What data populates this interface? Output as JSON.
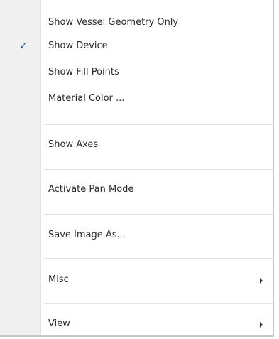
{
  "menu": {
    "items": [
      {
        "label": "Show Vessel Geometry Only"
      },
      {
        "label": "Show Device",
        "checked": true,
        "check_glyph": "✓"
      },
      {
        "label": "Show Fill Points"
      },
      {
        "label": "Material Color ..."
      },
      {
        "label": "Show Axes"
      },
      {
        "label": "Activate Pan Mode"
      },
      {
        "label": "Save Image As..."
      },
      {
        "label": "Misc",
        "has_submenu": true
      },
      {
        "label": "View",
        "has_submenu": true
      }
    ]
  },
  "colors": {
    "check_accent": "#2a5aa8",
    "gutter": "#f0f0f0",
    "separator": "#e3e3e3"
  },
  "icons": {
    "check": "check-icon",
    "submenu": "submenu-arrow-icon"
  }
}
